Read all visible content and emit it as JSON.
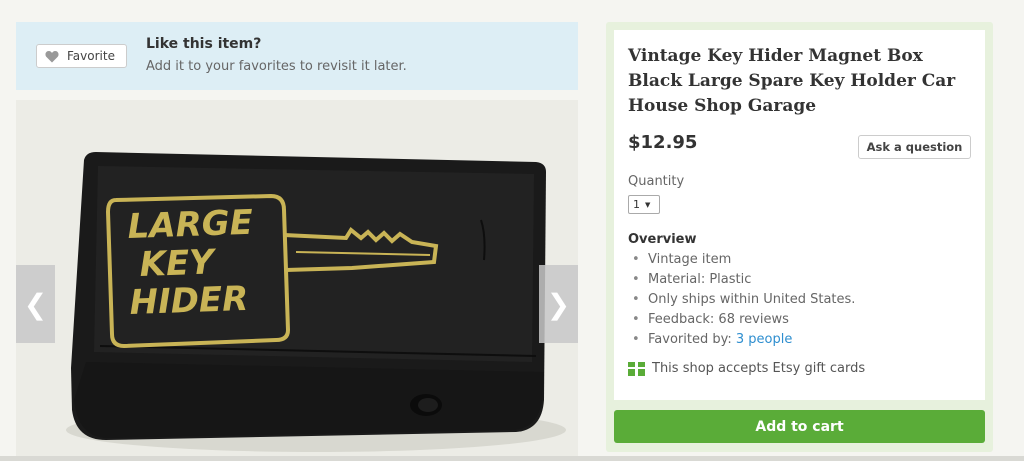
{
  "favorite": {
    "button_label": "Favorite",
    "title": "Like this item?",
    "subtitle": "Add it to your favorites to revisit it later."
  },
  "gallery": {
    "box_text_line1": "LARGE",
    "box_text_line2": "KEY",
    "box_text_line3": "HIDER",
    "prev_icon": "chevron-left-icon",
    "next_icon": "chevron-right-icon"
  },
  "listing": {
    "title": "Vintage Key Hider Magnet Box Black Large Spare Key Holder Car House Shop Garage",
    "price": "$12.95",
    "ask_label": "Ask a question",
    "quantity_label": "Quantity",
    "quantity_value": "1",
    "overview_title": "Overview",
    "overview": [
      "Vintage item",
      "Material: Plastic",
      "Only ships within United States.",
      "Feedback: 68 reviews"
    ],
    "favorited_prefix": "Favorited by: ",
    "favorited_link": "3 people",
    "gift_text": "This shop accepts Etsy gift cards",
    "cart_label": "Add to cart"
  },
  "colors": {
    "accent_green": "#5aac38",
    "link_blue": "#2e8ecf",
    "banner_blue": "#ddeef5"
  }
}
